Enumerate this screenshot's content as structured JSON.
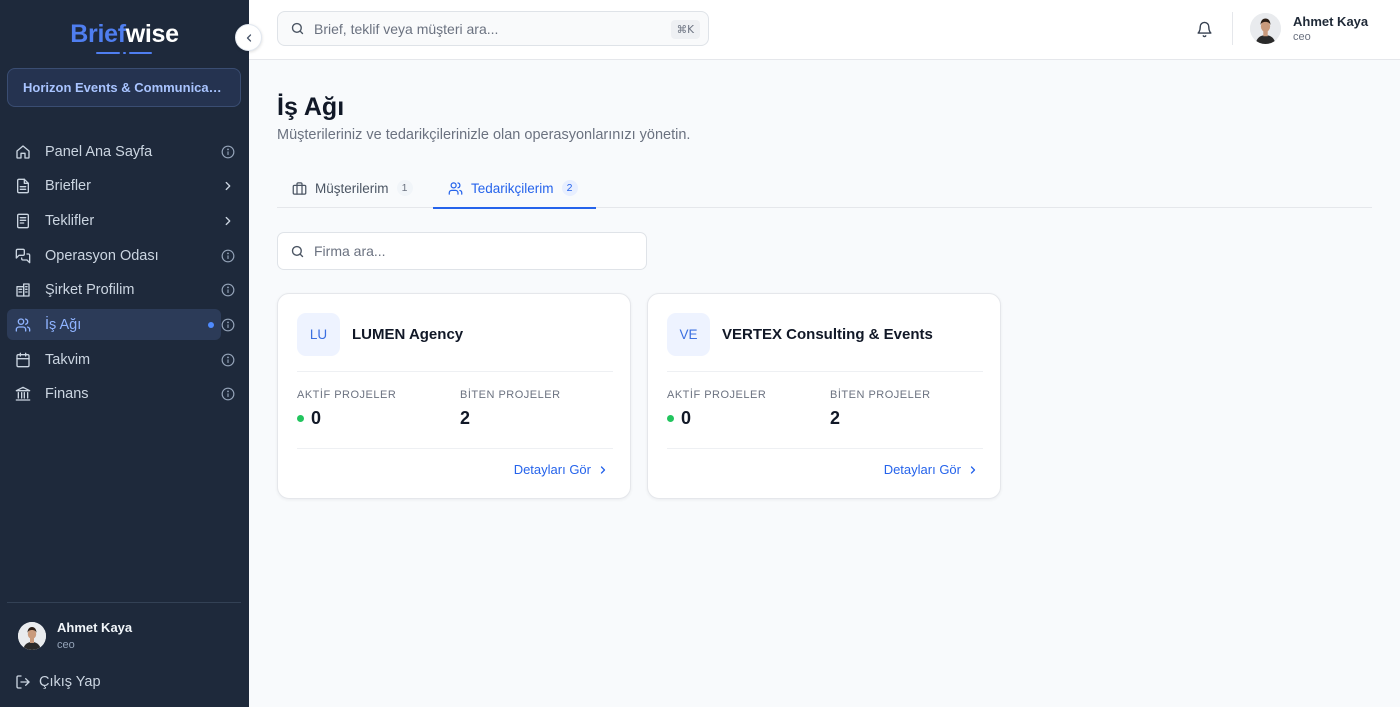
{
  "brand": {
    "part1": "Brief",
    "part2": "wise"
  },
  "sidebar": {
    "company": "Horizon Events & Communications",
    "items": [
      {
        "label": "Panel Ana Sayfa",
        "icon": "home-icon",
        "right": "info-icon"
      },
      {
        "label": "Briefler",
        "icon": "file-icon",
        "right": "chevron-right-icon"
      },
      {
        "label": "Teklifler",
        "icon": "document-icon",
        "right": "chevron-right-icon"
      },
      {
        "label": "Operasyon Odası",
        "icon": "chat-icon",
        "right": "info-icon"
      },
      {
        "label": "Şirket Profilim",
        "icon": "building-icon",
        "right": "info-icon"
      },
      {
        "label": "İş Ağı",
        "icon": "users-icon",
        "right": "info-icon",
        "active": true
      },
      {
        "label": "Takvim",
        "icon": "calendar-icon",
        "right": "info-icon"
      },
      {
        "label": "Finans",
        "icon": "bank-icon",
        "right": "info-icon"
      }
    ],
    "user": {
      "name": "Ahmet Kaya",
      "role": "ceo"
    },
    "logout": "Çıkış Yap"
  },
  "topbar": {
    "search_placeholder": "Brief, teklif veya müşteri ara...",
    "shortcut": "⌘K",
    "user": {
      "name": "Ahmet Kaya",
      "role": "ceo"
    }
  },
  "page": {
    "title": "İş Ağı",
    "subtitle": "Müşterileriniz ve tedarikçilerinizle olan operasyonlarınızı yönetin.",
    "tabs": [
      {
        "label": "Müşterilerim",
        "count": "1"
      },
      {
        "label": "Tedarikçilerim",
        "count": "2"
      }
    ],
    "firm_search_placeholder": "Firma ara...",
    "cards": [
      {
        "initials": "LU",
        "name": "LUMEN Agency",
        "active_label": "AKTİF PROJELER",
        "active": "0",
        "done_label": "BİTEN PROJELER",
        "done": "2",
        "detail": "Detayları Gör"
      },
      {
        "initials": "VE",
        "name": "VERTEX Consulting & Events",
        "active_label": "AKTİF PROJELER",
        "active": "0",
        "done_label": "BİTEN PROJELER",
        "done": "2",
        "detail": "Detayları Gör"
      }
    ]
  },
  "colors": {
    "sidebar_bg": "#1e293b",
    "accent": "#2563eb",
    "active_green": "#22c55e"
  }
}
